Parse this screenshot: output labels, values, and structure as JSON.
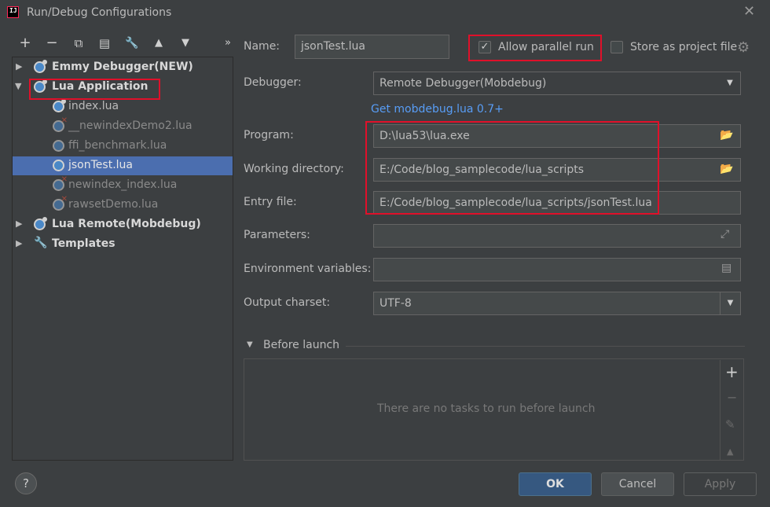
{
  "window": {
    "title": "Run/Debug Configurations",
    "logo_text": "IJ"
  },
  "toolbar": {
    "add": "+",
    "remove": "−",
    "copy": "⧉",
    "save": "▤",
    "edit": "🔧",
    "up": "▲",
    "down": "▼",
    "more": "»"
  },
  "tree": {
    "items": [
      {
        "label": "Emmy Debugger(NEW)",
        "kind": "group"
      },
      {
        "label": "Lua Application",
        "kind": "group",
        "expanded": true
      },
      {
        "label": "index.lua",
        "kind": "child"
      },
      {
        "label": "__newindexDemo2.lua",
        "kind": "child",
        "error": true
      },
      {
        "label": "ffi_benchmark.lua",
        "kind": "child"
      },
      {
        "label": "jsonTest.lua",
        "kind": "child",
        "selected": true
      },
      {
        "label": "newindex_index.lua",
        "kind": "child",
        "error": true
      },
      {
        "label": "rawsetDemo.lua",
        "kind": "child",
        "error": true
      },
      {
        "label": "Lua Remote(Mobdebug)",
        "kind": "group"
      },
      {
        "label": "Templates",
        "kind": "group"
      }
    ]
  },
  "form": {
    "name_label": "Name:",
    "name_value": "jsonTest.lua",
    "allow_parallel_label": "Allow parallel run",
    "allow_parallel_checked": true,
    "store_project_label": "Store as project file",
    "debugger_label": "Debugger:",
    "debugger_value": "Remote Debugger(Mobdebug)",
    "mobdebug_link": "Get mobdebug.lua 0.7+",
    "program_label": "Program:",
    "program_value": "D:\\lua53\\lua.exe",
    "workdir_label": "Working directory:",
    "workdir_value": "E:/Code/blog_samplecode/lua_scripts",
    "entry_label": "Entry file:",
    "entry_value": "E:/Code/blog_samplecode/lua_scripts/jsonTest.lua",
    "params_label": "Parameters:",
    "params_value": "",
    "env_label": "Environment variables:",
    "env_value": "",
    "charset_label": "Output charset:",
    "charset_value": "UTF-8"
  },
  "before_launch": {
    "title": "Before launch",
    "empty_text": "There are no tasks to run before launch"
  },
  "buttons": {
    "help": "?",
    "ok": "OK",
    "cancel": "Cancel",
    "apply": "Apply"
  },
  "colors": {
    "background": "#3c3f41",
    "selection": "#4b6eaf",
    "highlight_box": "#e0102a",
    "link": "#589df6",
    "primary_button": "#365880"
  }
}
